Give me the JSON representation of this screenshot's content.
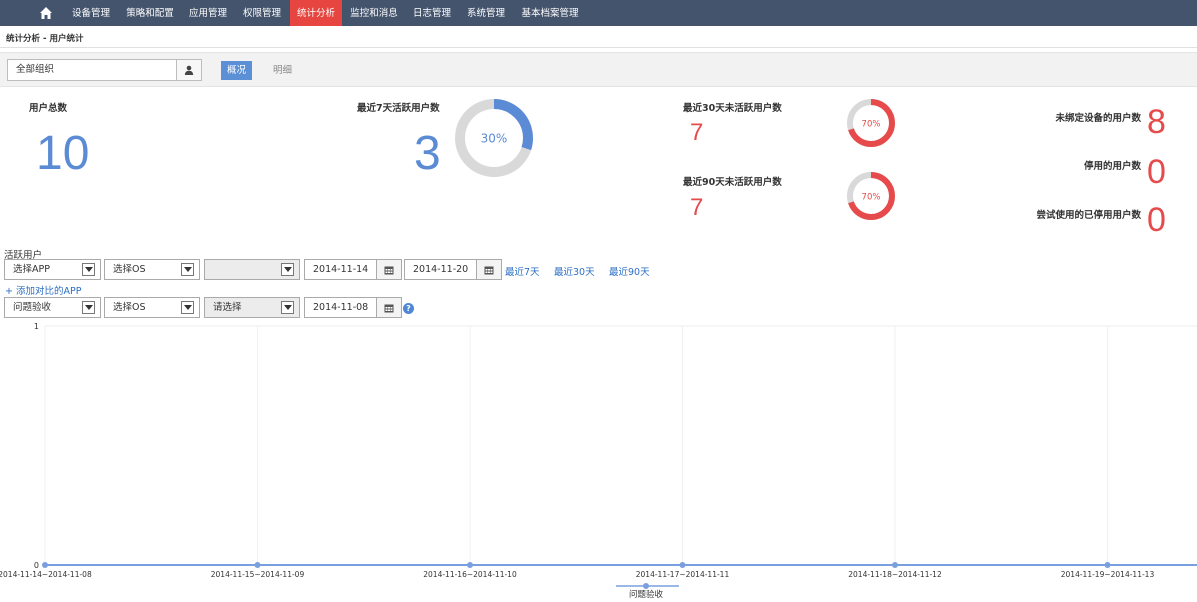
{
  "nav": {
    "items": [
      {
        "label": "设备管理"
      },
      {
        "label": "策略和配置"
      },
      {
        "label": "应用管理"
      },
      {
        "label": "权限管理"
      },
      {
        "label": "统计分析",
        "active": true
      },
      {
        "label": "监控和消息"
      },
      {
        "label": "日志管理"
      },
      {
        "label": "系统管理"
      },
      {
        "label": "基本档案管理"
      }
    ],
    "home_icon": "home-icon"
  },
  "breadcrumb": "统计分析 - 用户统计",
  "filter": {
    "org_value": "全部组织",
    "org_icon": "user-icon",
    "tab_overview": "概况",
    "tab_detail": "明细"
  },
  "stats": {
    "total": {
      "label": "用户总数",
      "value": "10"
    },
    "active7": {
      "label": "最近7天活跃用户数",
      "value": "3",
      "percent": "30%",
      "fraction": 0.3
    },
    "inactive30": {
      "label": "最近30天未活跃用户数",
      "value": "7",
      "percent": "70%",
      "fraction": 0.7
    },
    "inactive90": {
      "label": "最近90天未活跃用户数",
      "value": "7",
      "percent": "70%",
      "fraction": 0.7
    },
    "unbound": {
      "label": "未绑定设备的用户数",
      "value": "8"
    },
    "disabled": {
      "label": "停用的用户数",
      "value": "0"
    },
    "tried_disabled": {
      "label": "尝试使用的已停用用户数",
      "value": "0"
    }
  },
  "colors": {
    "accent_blue": "#5b8bd4",
    "accent_red": "#e64a4a",
    "donut_track": "#d9d9d9",
    "nav_bg": "#44546d",
    "nav_active": "#e6463f"
  },
  "active_users": {
    "section_label": "活跃用户",
    "select_app": "选择APP",
    "select_os": "选择OS",
    "select_third": "",
    "date_from": "2014-11-14",
    "date_to": "2014-11-20",
    "quick_7": "最近7天",
    "quick_30": "最近30天",
    "quick_90": "最近90天",
    "add_compare": "+ 添加对比的APP",
    "row2_app": "问题验收",
    "row2_os": "选择OS",
    "row2_pick": "请选择",
    "row2_date": "2014-11-08",
    "help": "?"
  },
  "chart_data": {
    "type": "line",
    "categories": [
      "2014-11-14~2014-11-08",
      "2014-11-15~2014-11-09",
      "2014-11-16~2014-11-10",
      "2014-11-17~2014-11-11",
      "2014-11-18~2014-11-12",
      "2014-11-19~2014-11-13"
    ],
    "series": [
      {
        "name": "问题验收",
        "values": [
          0,
          0,
          0,
          0,
          0,
          0
        ]
      }
    ],
    "ylim": [
      0,
      1
    ],
    "yticks": [
      "0",
      "1"
    ],
    "grid": true,
    "legend": "bottom",
    "color": "#7a9fde"
  }
}
